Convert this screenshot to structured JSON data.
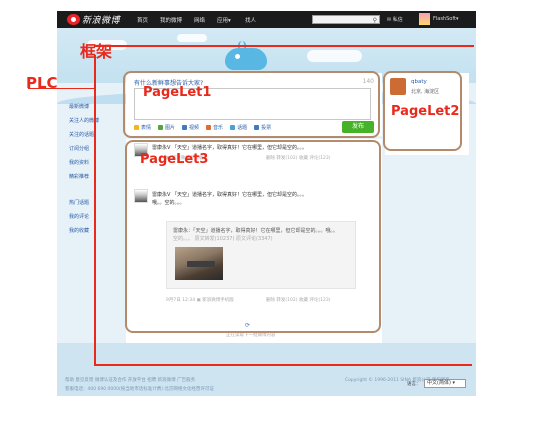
{
  "topbar": {
    "logo_text": "新浪微博",
    "nav": [
      "首页",
      "我的微博",
      "网络",
      "应用▾",
      "找人"
    ],
    "message": "✉ 私信",
    "user": "FlashSoft▾"
  },
  "left_nav": {
    "items": [
      "最新微博",
      "关注人的微博",
      "关注的话题",
      "订阅分组",
      "我的资料",
      "精彩推荐",
      "热门话题",
      "我的评论",
      "我的收藏"
    ]
  },
  "publisher": {
    "prompt": "有什么新鲜事想告诉大家?",
    "counter": "140",
    "tools": [
      "表情",
      "图片",
      "视频",
      "音乐",
      "话题",
      "投票"
    ],
    "publish_label": "发布"
  },
  "right_panel": {
    "name": "qbaty",
    "location": "北京, 海淀区"
  },
  "feed": {
    "posts": [
      {
        "text": "雷康永V 「天空」道播名字，取得真好！它在哪里，但它却是空的。。。",
        "meta": "▣ 新浪微博手机版",
        "actions": "删除   转发(102)   收藏   评论(123)"
      },
      {
        "text": "雷康永V 「天空」道播名字，取得真好！它在哪里，但它却是空的。。。",
        "text2": "哦。。空的。。。",
        "actions": "删除   转发(102)   收藏   评论(123)"
      }
    ],
    "repost": {
      "line1": "雷康永：「天空」道播名字，取得真好！它在哪里，但它却是空的。。。哦。。",
      "line2": "空的。。。  原文转发(10237)   原文评论(3347)"
    },
    "post2_meta": "9月7日 12:34   ▣ 新浪微博手机版",
    "post2_actions": "删除   转发(102)   收藏   评论(123)",
    "loading": "正在读取下一批微博内容"
  },
  "footer": {
    "line1": "帮助   意见反馈   微博认证及合作   开放平台   招聘   新浪微博   广告服务",
    "line2": "客服电话：400 690 0000(按当地市话标准计费)   北京网络文化经营许可证",
    "copyright": "Copyright © 1996-2011 SINA   新浪公司 版权所有",
    "lang_label": "语言：",
    "lang_value": "中文(简体) ▾"
  },
  "annotations": {
    "frame": "框架",
    "plc": "PLC",
    "pagelet1": "PageLet1",
    "pagelet2": "PageLet2",
    "pagelet3": "PageLet3"
  },
  "colors": {
    "annotation_red": "#e8291c",
    "box_border": "#b48a6b",
    "publish_green": "#47b129",
    "link_blue": "#2a5ca8",
    "topbar_black": "#1b1b1b"
  }
}
